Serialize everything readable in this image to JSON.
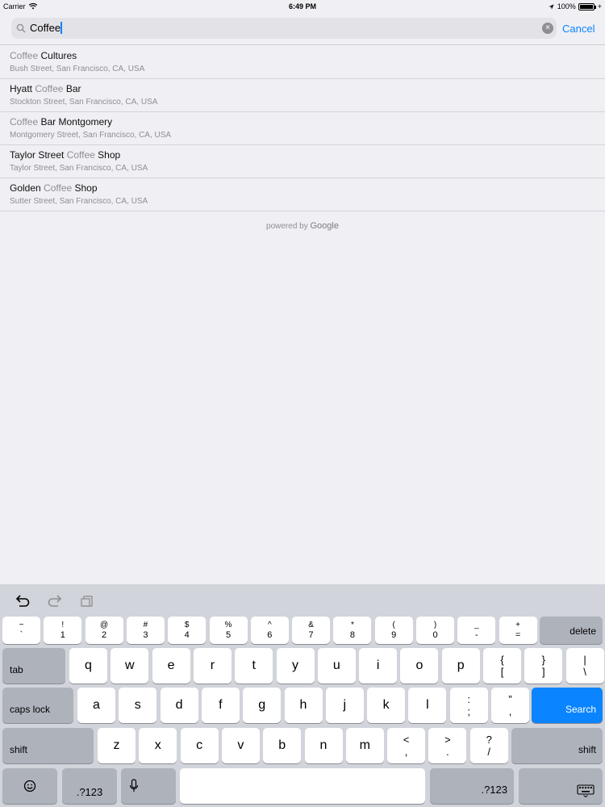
{
  "status_bar": {
    "carrier": "Carrier",
    "time": "6:49 PM",
    "battery": "100%",
    "battery_level": 1.0
  },
  "search": {
    "query": "Coffee",
    "cancel_label": "Cancel"
  },
  "results": [
    {
      "pre": "",
      "hl": "Coffee",
      "post": " Cultures",
      "subtitle": "Bush Street, San Francisco, CA, USA"
    },
    {
      "pre": "Hyatt ",
      "hl": "Coffee",
      "post": " Bar",
      "subtitle": "Stockton Street, San Francisco, CA, USA"
    },
    {
      "pre": "",
      "hl": "Coffee",
      "post": " Bar Montgomery",
      "subtitle": "Montgomery Street, San Francisco, CA, USA"
    },
    {
      "pre": "Taylor Street ",
      "hl": "Coffee",
      "post": " Shop",
      "subtitle": "Taylor Street, San Francisco, CA, USA"
    },
    {
      "pre": "Golden ",
      "hl": "Coffee",
      "post": " Shop",
      "subtitle": "Sutter Street, San Francisco, CA, USA"
    }
  ],
  "attribution": {
    "prefix": "powered by ",
    "brand": "Google"
  },
  "keyboard": {
    "number_row": [
      {
        "top": "~",
        "bottom": "`"
      },
      {
        "top": "!",
        "bottom": "1"
      },
      {
        "top": "@",
        "bottom": "2"
      },
      {
        "top": "#",
        "bottom": "3"
      },
      {
        "top": "$",
        "bottom": "4"
      },
      {
        "top": "%",
        "bottom": "5"
      },
      {
        "top": "^",
        "bottom": "6"
      },
      {
        "top": "&",
        "bottom": "7"
      },
      {
        "top": "*",
        "bottom": "8"
      },
      {
        "top": "(",
        "bottom": "9"
      },
      {
        "top": ")",
        "bottom": "0"
      },
      {
        "top": "_",
        "bottom": "-"
      },
      {
        "top": "+",
        "bottom": "="
      }
    ],
    "delete_label": "delete",
    "tab_label": "tab",
    "row_q": [
      "q",
      "w",
      "e",
      "r",
      "t",
      "y",
      "u",
      "i",
      "o",
      "p"
    ],
    "row_q_extra": [
      {
        "top": "{",
        "bottom": "["
      },
      {
        "top": "}",
        "bottom": "]"
      },
      {
        "top": "|",
        "bottom": "\\"
      }
    ],
    "caps_label": "caps lock",
    "row_a": [
      "a",
      "s",
      "d",
      "f",
      "g",
      "h",
      "j",
      "k",
      "l"
    ],
    "row_a_extra": [
      {
        "top": ":",
        "bottom": ";"
      },
      {
        "top": "”",
        "bottom": ","
      }
    ],
    "search_label": "Search",
    "shift_label": "shift",
    "row_z": [
      "z",
      "x",
      "c",
      "v",
      "b",
      "n",
      "m"
    ],
    "row_z_extra": [
      {
        "top": "<",
        "bottom": ","
      },
      {
        "top": ">",
        "bottom": "."
      },
      {
        "top": "?",
        "bottom": "/"
      }
    ],
    "numbers_label": ".?123"
  },
  "colors": {
    "accent": "#0a84ff",
    "background": "#efeff4",
    "keyboard_bg": "#d1d4da"
  }
}
